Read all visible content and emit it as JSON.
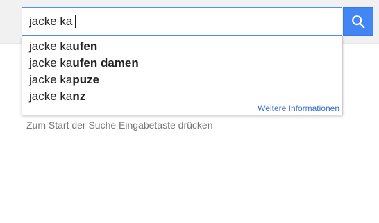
{
  "search": {
    "query": "jacke ka",
    "button_icon": "search-icon",
    "accent_color": "#4285f4"
  },
  "suggestions": {
    "items": [
      {
        "typed": "jacke ka",
        "completion": "ufen"
      },
      {
        "typed": "jacke ka",
        "completion": "ufen damen"
      },
      {
        "typed": "jacke ka",
        "completion": "puze"
      },
      {
        "typed": "jacke ka",
        "completion": "nz"
      }
    ],
    "more_info_label": "Weitere Informationen"
  },
  "hint_text": "Zum Start der Suche Eingabetaste drücken"
}
